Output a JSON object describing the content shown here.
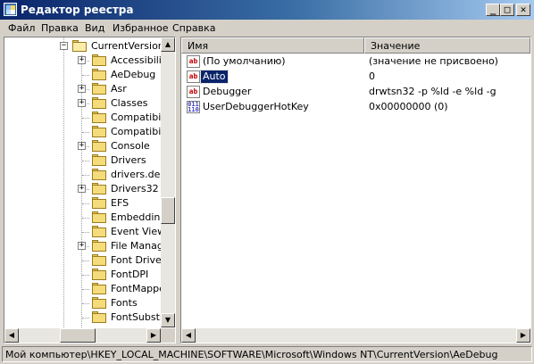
{
  "window": {
    "title": "Редактор реестра",
    "min_glyph": "_",
    "max_glyph": "□",
    "close_glyph": "✕"
  },
  "menu": [
    "Файл",
    "Правка",
    "Вид",
    "Избранное",
    "Справка"
  ],
  "tree": {
    "parent": {
      "label": "CurrentVersion",
      "expander": "−",
      "icon": "folder-open-icon"
    },
    "children": [
      {
        "label": "Accessibility",
        "expander": "+"
      },
      {
        "label": "AeDebug",
        "expander": ""
      },
      {
        "label": "Asr",
        "expander": "+"
      },
      {
        "label": "Classes",
        "expander": "+"
      },
      {
        "label": "Compatibility",
        "expander": ""
      },
      {
        "label": "Compatibility",
        "expander": ""
      },
      {
        "label": "Console",
        "expander": "+"
      },
      {
        "label": "Drivers",
        "expander": ""
      },
      {
        "label": "drivers.desc",
        "expander": ""
      },
      {
        "label": "Drivers32",
        "expander": "+"
      },
      {
        "label": "EFS",
        "expander": ""
      },
      {
        "label": "Embedding",
        "expander": ""
      },
      {
        "label": "Event Viewe",
        "expander": ""
      },
      {
        "label": "File Manager",
        "expander": "+"
      },
      {
        "label": "Font Drivers",
        "expander": ""
      },
      {
        "label": "FontDPI",
        "expander": ""
      },
      {
        "label": "FontMapper",
        "expander": ""
      },
      {
        "label": "Fonts",
        "expander": ""
      },
      {
        "label": "FontSubstitu",
        "expander": ""
      }
    ]
  },
  "list": {
    "columns": [
      "Имя",
      "Значение"
    ],
    "rows": [
      {
        "icon": "string-value-icon",
        "icon_text": "ab",
        "name": "(По умолчанию)",
        "data": "(значение не присвоено)",
        "selected": false
      },
      {
        "icon": "string-value-icon",
        "icon_text": "ab",
        "name": "Auto",
        "data": "0",
        "selected": true
      },
      {
        "icon": "string-value-icon",
        "icon_text": "ab",
        "name": "Debugger",
        "data": "drwtsn32 -p %ld -e %ld -g",
        "selected": false
      },
      {
        "icon": "binary-value-icon",
        "icon_text": "011\n110",
        "name": "UserDebuggerHotKey",
        "data": "0x00000000 (0)",
        "selected": false
      }
    ]
  },
  "statusbar": {
    "path": "Мой компьютер\\HKEY_LOCAL_MACHINE\\SOFTWARE\\Microsoft\\Windows NT\\CurrentVersion\\AeDebug"
  },
  "colors": {
    "title_start": "#0a246a",
    "title_end": "#a6caf0",
    "selection": "#0a246a",
    "face": "#d4d0c8"
  },
  "scroll": {
    "left_vertical_position": 0.62,
    "left_horizontal_position": 0.45
  }
}
